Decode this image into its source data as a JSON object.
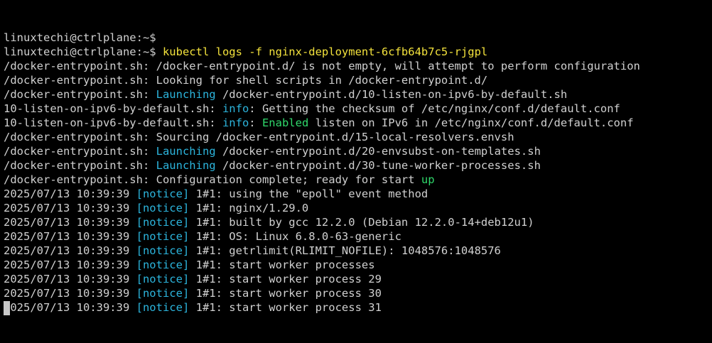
{
  "terminal": {
    "lines": [
      {
        "kind": "prompt",
        "prompt": "linuxtechi@ctrlplane:~$",
        "command": ""
      },
      {
        "kind": "prompt",
        "prompt": "linuxtechi@ctrlplane:~$",
        "command": " kubectl logs -f nginx-deployment-6cfb64b7c5-rjgpl"
      },
      {
        "kind": "text",
        "segments": [
          {
            "t": "/docker-entrypoint.sh: /docker-entrypoint.d/ is not empty, will attempt to perform configuration",
            "c": ""
          }
        ]
      },
      {
        "kind": "text",
        "segments": [
          {
            "t": "/docker-entrypoint.sh: Looking for shell scripts in /docker-entrypoint.d/",
            "c": ""
          }
        ]
      },
      {
        "kind": "text",
        "segments": [
          {
            "t": "/docker-entrypoint.sh: ",
            "c": ""
          },
          {
            "t": "Launching",
            "c": "cyan"
          },
          {
            "t": " /docker-entrypoint.d/10-listen-on-ipv6-by-default.sh",
            "c": ""
          }
        ]
      },
      {
        "kind": "text",
        "segments": [
          {
            "t": "10-listen-on-ipv6-by-default.sh: ",
            "c": ""
          },
          {
            "t": "info",
            "c": "cyan"
          },
          {
            "t": ": Getting the checksum of /etc/nginx/conf.d/default.conf",
            "c": ""
          }
        ]
      },
      {
        "kind": "text",
        "segments": [
          {
            "t": "10-listen-on-ipv6-by-default.sh: ",
            "c": ""
          },
          {
            "t": "info",
            "c": "cyan"
          },
          {
            "t": ": ",
            "c": ""
          },
          {
            "t": "Enabled",
            "c": "green"
          },
          {
            "t": " listen on IPv6 in /etc/nginx/conf.d/default.conf",
            "c": ""
          }
        ]
      },
      {
        "kind": "text",
        "segments": [
          {
            "t": "/docker-entrypoint.sh: Sourcing /docker-entrypoint.d/15-local-resolvers.envsh",
            "c": ""
          }
        ]
      },
      {
        "kind": "text",
        "segments": [
          {
            "t": "/docker-entrypoint.sh: ",
            "c": ""
          },
          {
            "t": "Launching",
            "c": "cyan"
          },
          {
            "t": " /docker-entrypoint.d/20-envsubst-on-templates.sh",
            "c": ""
          }
        ]
      },
      {
        "kind": "text",
        "segments": [
          {
            "t": "/docker-entrypoint.sh: ",
            "c": ""
          },
          {
            "t": "Launching",
            "c": "cyan"
          },
          {
            "t": " /docker-entrypoint.d/30-tune-worker-processes.sh",
            "c": ""
          }
        ]
      },
      {
        "kind": "text",
        "segments": [
          {
            "t": "/docker-entrypoint.sh: Configuration complete; ready for start ",
            "c": ""
          },
          {
            "t": "up",
            "c": "green"
          }
        ]
      },
      {
        "kind": "text",
        "segments": [
          {
            "t": "2025/07/13 10:39:39 ",
            "c": ""
          },
          {
            "t": "[notice]",
            "c": "cyan"
          },
          {
            "t": " 1#1: using the \"epoll\" event method",
            "c": ""
          }
        ]
      },
      {
        "kind": "text",
        "segments": [
          {
            "t": "2025/07/13 10:39:39 ",
            "c": ""
          },
          {
            "t": "[notice]",
            "c": "cyan"
          },
          {
            "t": " 1#1: nginx/1.29.0",
            "c": ""
          }
        ]
      },
      {
        "kind": "text",
        "segments": [
          {
            "t": "2025/07/13 10:39:39 ",
            "c": ""
          },
          {
            "t": "[notice]",
            "c": "cyan"
          },
          {
            "t": " 1#1: built by gcc 12.2.0 (Debian 12.2.0-14+deb12u1)",
            "c": ""
          }
        ]
      },
      {
        "kind": "text",
        "segments": [
          {
            "t": "2025/07/13 10:39:39 ",
            "c": ""
          },
          {
            "t": "[notice]",
            "c": "cyan"
          },
          {
            "t": " 1#1: OS: Linux 6.8.0-63-generic",
            "c": ""
          }
        ]
      },
      {
        "kind": "text",
        "segments": [
          {
            "t": "2025/07/13 10:39:39 ",
            "c": ""
          },
          {
            "t": "[notice]",
            "c": "cyan"
          },
          {
            "t": " 1#1: getrlimit(RLIMIT_NOFILE): 1048576:1048576",
            "c": ""
          }
        ]
      },
      {
        "kind": "text",
        "segments": [
          {
            "t": "2025/07/13 10:39:39 ",
            "c": ""
          },
          {
            "t": "[notice]",
            "c": "cyan"
          },
          {
            "t": " 1#1: start worker processes",
            "c": ""
          }
        ]
      },
      {
        "kind": "text",
        "segments": [
          {
            "t": "2025/07/13 10:39:39 ",
            "c": ""
          },
          {
            "t": "[notice]",
            "c": "cyan"
          },
          {
            "t": " 1#1: start worker process 29",
            "c": ""
          }
        ]
      },
      {
        "kind": "text",
        "segments": [
          {
            "t": "2025/07/13 10:39:39 ",
            "c": ""
          },
          {
            "t": "[notice]",
            "c": "cyan"
          },
          {
            "t": " 1#1: start worker process 30",
            "c": ""
          }
        ]
      },
      {
        "kind": "text",
        "segments": [
          {
            "t": "2025/07/13 10:39:39 ",
            "c": ""
          },
          {
            "t": "[notice]",
            "c": "cyan"
          },
          {
            "t": " 1#1: start worker process 31",
            "c": ""
          }
        ]
      }
    ]
  },
  "colors": {
    "background": "#000000",
    "text": "#d0d0d0",
    "command": "#f3e23c",
    "cyan": "#2cb5dd",
    "green": "#2fd86b"
  }
}
